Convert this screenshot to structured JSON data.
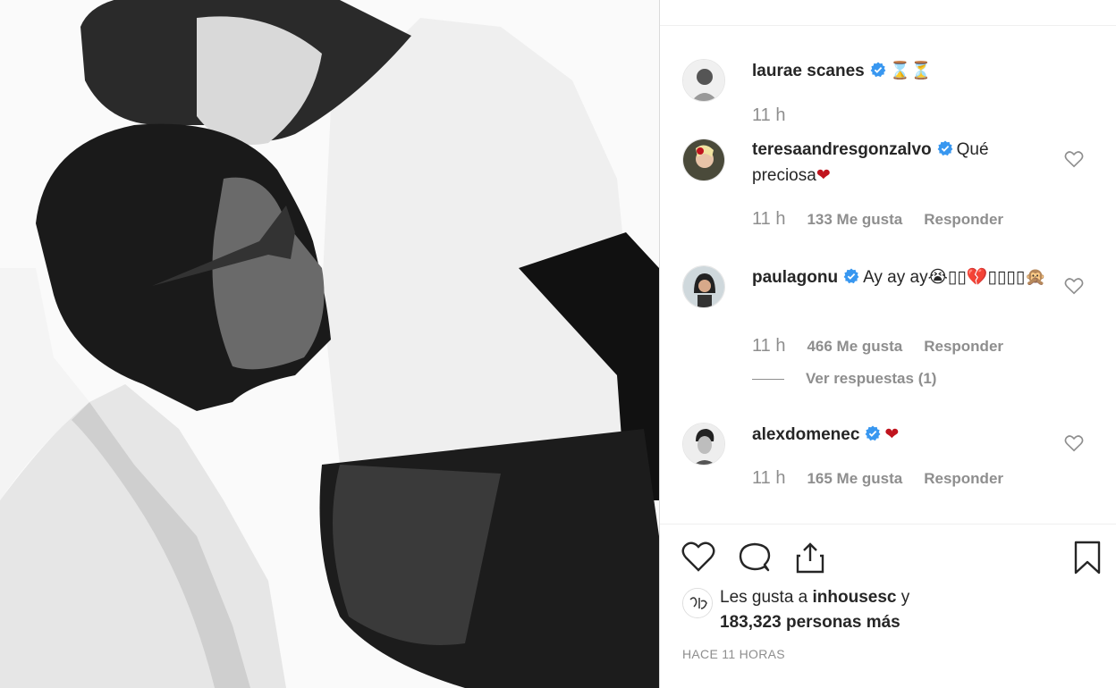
{
  "post": {
    "author": {
      "username": "laurae scanes",
      "caption_emoji": "⌛⏳",
      "time": "11 h"
    },
    "comments": [
      {
        "username": "teresaandresgonzalvo",
        "text": "Qué preciosa",
        "emoji": "❤",
        "time": "11 h",
        "likes": "133 Me gusta",
        "reply": "Responder"
      },
      {
        "username": "paulagonu",
        "text": "Ay ay ay",
        "emoji": "😭▯▯💔▯▯▯▯🙊",
        "time": "11 h",
        "likes": "466 Me gusta",
        "reply": "Responder",
        "view_replies": "Ver respuestas (1)"
      },
      {
        "username": "alexdomenec",
        "text": "",
        "emoji": "❤",
        "time": "11 h",
        "likes": "165 Me gusta",
        "reply": "Responder"
      }
    ],
    "likes_summary": {
      "prefix": "Les gusta a ",
      "user": "inhousesc",
      "suffix": " y",
      "count_text": "183,323 personas más"
    },
    "timestamp": "HACE 11 HORAS",
    "icons": {
      "like": "heart-icon",
      "comment": "comment-icon",
      "share": "share-icon",
      "save": "bookmark-icon",
      "verified": "verified-badge-icon"
    },
    "colors": {
      "verified": "#3897f0",
      "heart": "#c0141e",
      "meta": "#8e8e8e"
    }
  }
}
